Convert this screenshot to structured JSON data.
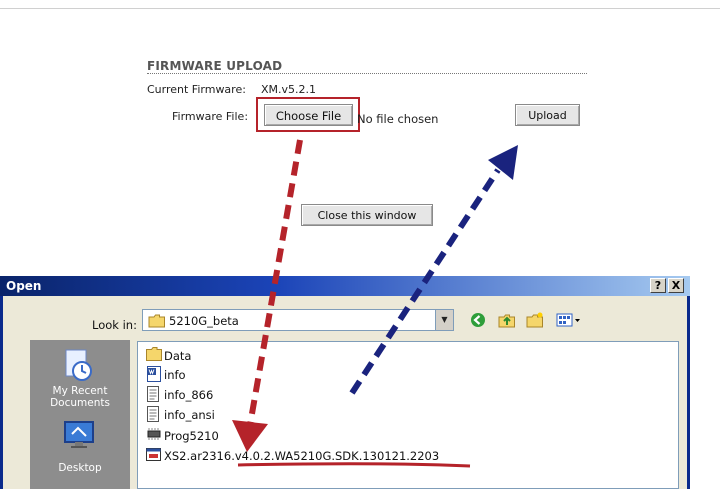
{
  "firmware": {
    "heading": "FIRMWARE UPLOAD",
    "current_label": "Current Firmware:",
    "current_value": "XM.v5.2.1",
    "file_label": "Firmware File:",
    "choose_button": "Choose File",
    "no_file_text": "No file chosen",
    "upload_button": "Upload",
    "close_button": "Close this window"
  },
  "dialog": {
    "title": "Open",
    "help_button": "?",
    "close_button": "X",
    "look_in_label": "Look in:",
    "look_in_value": "5210G_beta",
    "places": [
      {
        "label": "My Recent Documents",
        "icon": "recent-documents-icon"
      },
      {
        "label": "Desktop",
        "icon": "desktop-icon"
      }
    ],
    "files": [
      {
        "name": "Data",
        "icon": "folder-icon"
      },
      {
        "name": "info",
        "icon": "word-document-icon"
      },
      {
        "name": "info_866",
        "icon": "text-file-icon"
      },
      {
        "name": "info_ansi",
        "icon": "text-file-icon"
      },
      {
        "name": "Prog5210",
        "icon": "chip-icon"
      },
      {
        "name": "XS2.ar2316.v4.0.2.WA5210G.SDK.130121.2203",
        "icon": "firmware-file-icon"
      }
    ]
  },
  "annotations": {
    "highlight_color": "#b5232a",
    "red_arrow_color": "#b5232a",
    "blue_arrow_color": "#1a237e"
  }
}
